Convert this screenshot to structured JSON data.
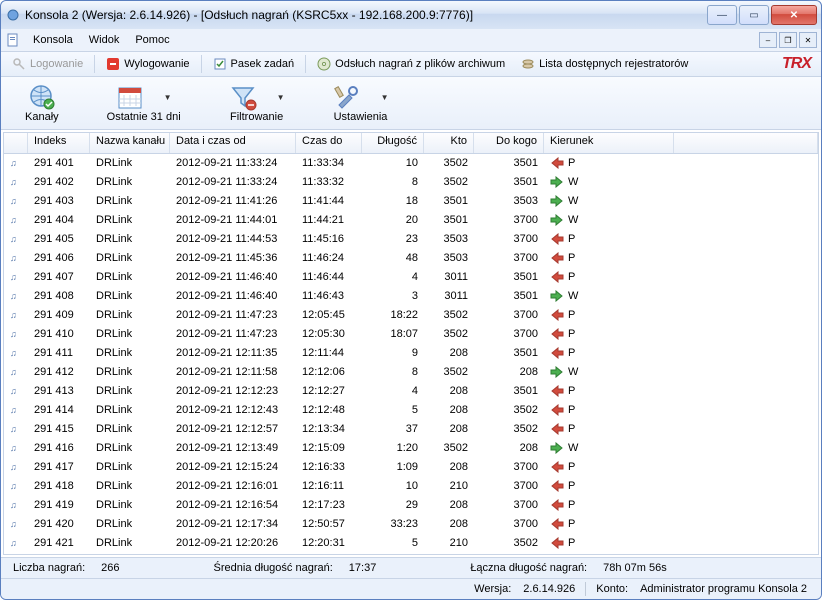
{
  "title": "Konsola 2 (Wersja:  2.6.14.926) - [Odsłuch nagrań (KSRC5xx - 192.168.200.9:7776)]",
  "menu": {
    "items": [
      "Konsola",
      "Widok",
      "Pomoc"
    ]
  },
  "toolbar": {
    "login": "Logowanie",
    "logout": "Wylogowanie",
    "taskbar": "Pasek zadań",
    "archive": "Odsłuch nagrań z plików archiwum",
    "recorders": "Lista dostępnych rejestratorów",
    "logo": "TRX"
  },
  "big": {
    "channels": "Kanały",
    "last31": "Ostatnie 31 dni",
    "filtering": "Filtrowanie",
    "settings": "Ustawienia"
  },
  "columns": [
    "",
    "Indeks",
    "Nazwa kanału",
    "Data i czas od",
    "Czas do",
    "Długość",
    "Kto",
    "Do kogo",
    "Kierunek",
    ""
  ],
  "rows": [
    {
      "idx": "291 401",
      "ch": "DRLink",
      "from": "2012-09-21 11:33:24",
      "to": "11:33:34",
      "dur": "10",
      "who": "3502",
      "to_who": "3501",
      "dir": "P"
    },
    {
      "idx": "291 402",
      "ch": "DRLink",
      "from": "2012-09-21 11:33:24",
      "to": "11:33:32",
      "dur": "8",
      "who": "3502",
      "to_who": "3501",
      "dir": "W"
    },
    {
      "idx": "291 403",
      "ch": "DRLink",
      "from": "2012-09-21 11:41:26",
      "to": "11:41:44",
      "dur": "18",
      "who": "3501",
      "to_who": "3503",
      "dir": "W"
    },
    {
      "idx": "291 404",
      "ch": "DRLink",
      "from": "2012-09-21 11:44:01",
      "to": "11:44:21",
      "dur": "20",
      "who": "3501",
      "to_who": "3700",
      "dir": "W"
    },
    {
      "idx": "291 405",
      "ch": "DRLink",
      "from": "2012-09-21 11:44:53",
      "to": "11:45:16",
      "dur": "23",
      "who": "3503",
      "to_who": "3700",
      "dir": "P"
    },
    {
      "idx": "291 406",
      "ch": "DRLink",
      "from": "2012-09-21 11:45:36",
      "to": "11:46:24",
      "dur": "48",
      "who": "3503",
      "to_who": "3700",
      "dir": "P"
    },
    {
      "idx": "291 407",
      "ch": "DRLink",
      "from": "2012-09-21 11:46:40",
      "to": "11:46:44",
      "dur": "4",
      "who": "3011",
      "to_who": "3501",
      "dir": "P"
    },
    {
      "idx": "291 408",
      "ch": "DRLink",
      "from": "2012-09-21 11:46:40",
      "to": "11:46:43",
      "dur": "3",
      "who": "3011",
      "to_who": "3501",
      "dir": "W"
    },
    {
      "idx": "291 409",
      "ch": "DRLink",
      "from": "2012-09-21 11:47:23",
      "to": "12:05:45",
      "dur": "18:22",
      "who": "3502",
      "to_who": "3700",
      "dir": "P"
    },
    {
      "idx": "291 410",
      "ch": "DRLink",
      "from": "2012-09-21 11:47:23",
      "to": "12:05:30",
      "dur": "18:07",
      "who": "3502",
      "to_who": "3700",
      "dir": "P"
    },
    {
      "idx": "291 411",
      "ch": "DRLink",
      "from": "2012-09-21 12:11:35",
      "to": "12:11:44",
      "dur": "9",
      "who": "208",
      "to_who": "3501",
      "dir": "P"
    },
    {
      "idx": "291 412",
      "ch": "DRLink",
      "from": "2012-09-21 12:11:58",
      "to": "12:12:06",
      "dur": "8",
      "who": "3502",
      "to_who": "208",
      "dir": "W"
    },
    {
      "idx": "291 413",
      "ch": "DRLink",
      "from": "2012-09-21 12:12:23",
      "to": "12:12:27",
      "dur": "4",
      "who": "208",
      "to_who": "3501",
      "dir": "P"
    },
    {
      "idx": "291 414",
      "ch": "DRLink",
      "from": "2012-09-21 12:12:43",
      "to": "12:12:48",
      "dur": "5",
      "who": "208",
      "to_who": "3502",
      "dir": "P"
    },
    {
      "idx": "291 415",
      "ch": "DRLink",
      "from": "2012-09-21 12:12:57",
      "to": "12:13:34",
      "dur": "37",
      "who": "208",
      "to_who": "3502",
      "dir": "P"
    },
    {
      "idx": "291 416",
      "ch": "DRLink",
      "from": "2012-09-21 12:13:49",
      "to": "12:15:09",
      "dur": "1:20",
      "who": "3502",
      "to_who": "208",
      "dir": "W"
    },
    {
      "idx": "291 417",
      "ch": "DRLink",
      "from": "2012-09-21 12:15:24",
      "to": "12:16:33",
      "dur": "1:09",
      "who": "208",
      "to_who": "3700",
      "dir": "P"
    },
    {
      "idx": "291 418",
      "ch": "DRLink",
      "from": "2012-09-21 12:16:01",
      "to": "12:16:11",
      "dur": "10",
      "who": "210",
      "to_who": "3700",
      "dir": "P"
    },
    {
      "idx": "291 419",
      "ch": "DRLink",
      "from": "2012-09-21 12:16:54",
      "to": "12:17:23",
      "dur": "29",
      "who": "208",
      "to_who": "3700",
      "dir": "P"
    },
    {
      "idx": "291 420",
      "ch": "DRLink",
      "from": "2012-09-21 12:17:34",
      "to": "12:50:57",
      "dur": "33:23",
      "who": "208",
      "to_who": "3700",
      "dir": "P"
    },
    {
      "idx": "291 421",
      "ch": "DRLink",
      "from": "2012-09-21 12:20:26",
      "to": "12:20:31",
      "dur": "5",
      "who": "210",
      "to_who": "3502",
      "dir": "P"
    }
  ],
  "status1": {
    "count_label": "Liczba nagrań:",
    "count_value": "266",
    "avg_label": "Średnia długość nagrań:",
    "avg_value": "17:37",
    "total_label": "Łączna długość nagrań:",
    "total_value": "78h 07m 56s"
  },
  "status2": {
    "version_label": "Wersja:",
    "version_value": "2.6.14.926",
    "account_label": "Konto:",
    "account_value": "Administrator programu Konsola 2"
  }
}
